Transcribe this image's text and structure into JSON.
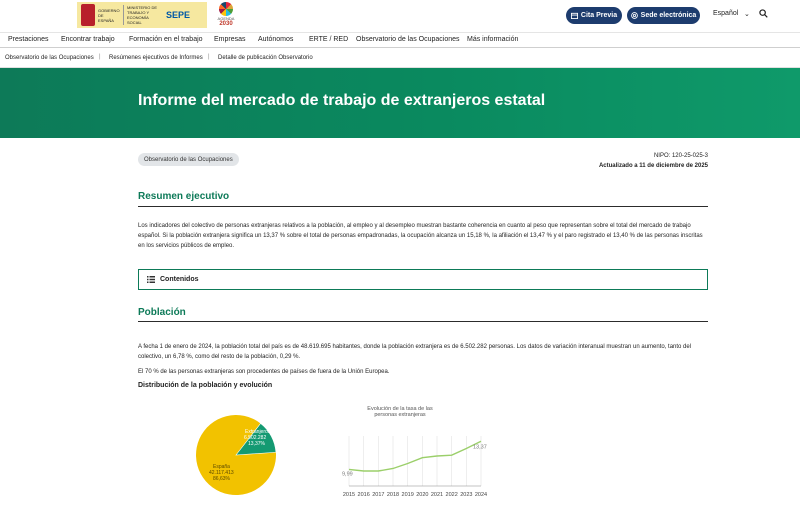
{
  "header": {
    "gob_label": "GOBIERNO DE ESPAÑA",
    "ministry_label": "MINISTERIO DE TRABAJO Y ECONOMÍA SOCIAL",
    "sepe_label": "SEPE",
    "agenda_label": "AGENDA",
    "agenda_year": "2030",
    "cita_label": "Cita Previa",
    "sede_label": "Sede electrónica",
    "language": "Español"
  },
  "nav": {
    "items": [
      "Prestaciones",
      "Encontrar trabajo",
      "Formación en el trabajo",
      "Empresas",
      "Autónomos",
      "ERTE / RED",
      "Observatorio de las Ocupaciones",
      "Más información"
    ]
  },
  "breadcrumb": [
    "Observatorio de las Ocupaciones",
    "Resúmenes ejecutivos de Informes",
    "Detalle de publicación Observatorio"
  ],
  "hero": {
    "title": "Informe del mercado de trabajo de extranjeros estatal"
  },
  "meta": {
    "tag": "Observatorio de las Ocupaciones",
    "nipo": "NIPO: 120-25-025-3",
    "updated": "Actualizado a 11 de diciembre de 2025"
  },
  "resumen": {
    "title": "Resumen ejecutivo",
    "text": "Los indicadores del colectivo de personas extranjeras relativos a la población, al empleo y al desempleo muestran bastante coherencia en cuanto al peso que representan sobre el total del mercado de trabajo español. Si la población extranjera significa un 13,37 % sobre el total de personas empadronadas, la ocupación alcanza un 15,18 %, la afiliación el 13,47 % y el paro registrado el 13,40 % de las personas inscritas en los servicios públicos de empleo."
  },
  "contents": {
    "label": "Contenidos"
  },
  "poblacion": {
    "title": "Población",
    "text1": "A fecha 1 de enero de 2024, la población total del país es de 48.619.695 habitantes, donde la población extranjera es de 6.502.282 personas. Los datos de variación interanual muestran un aumento, tanto del colectivo, un 6,78 %, como del resto de la población, 0,29 %.",
    "text2": "El 70 % de las personas extranjeras son procedentes de países de fuera de la Unión Europea.",
    "chart_section_title": "Distribución de la población y evolución"
  },
  "colors": {
    "brand_green": "#0d7a58",
    "pie_spain": "#f2c200",
    "pie_foreign": "#149a72",
    "line": "#9bcf6a",
    "nav_button": "#1d3c6e"
  },
  "chart_data": [
    {
      "type": "pie",
      "title": "",
      "slices": [
        {
          "label": "España",
          "value": 42117413,
          "value_label": "42.117.413",
          "percent_label": "86,63%"
        },
        {
          "label": "Extranjeros",
          "value": 6502282,
          "value_label": "6.502.282",
          "percent_label": "13,37%"
        }
      ]
    },
    {
      "type": "line",
      "title": "Evolución de la tasa de las personas extranjeras",
      "x": [
        "2015",
        "2016",
        "2017",
        "2018",
        "2019",
        "2020",
        "2021",
        "2022",
        "2023",
        "2024"
      ],
      "values": [
        9.99,
        9.8,
        9.8,
        10.1,
        10.7,
        11.4,
        11.6,
        11.7,
        12.5,
        13.37
      ],
      "labels": {
        "first": "9,99",
        "last": "13,37"
      },
      "ylim": [
        8,
        14
      ],
      "grid": "vertical"
    }
  ]
}
